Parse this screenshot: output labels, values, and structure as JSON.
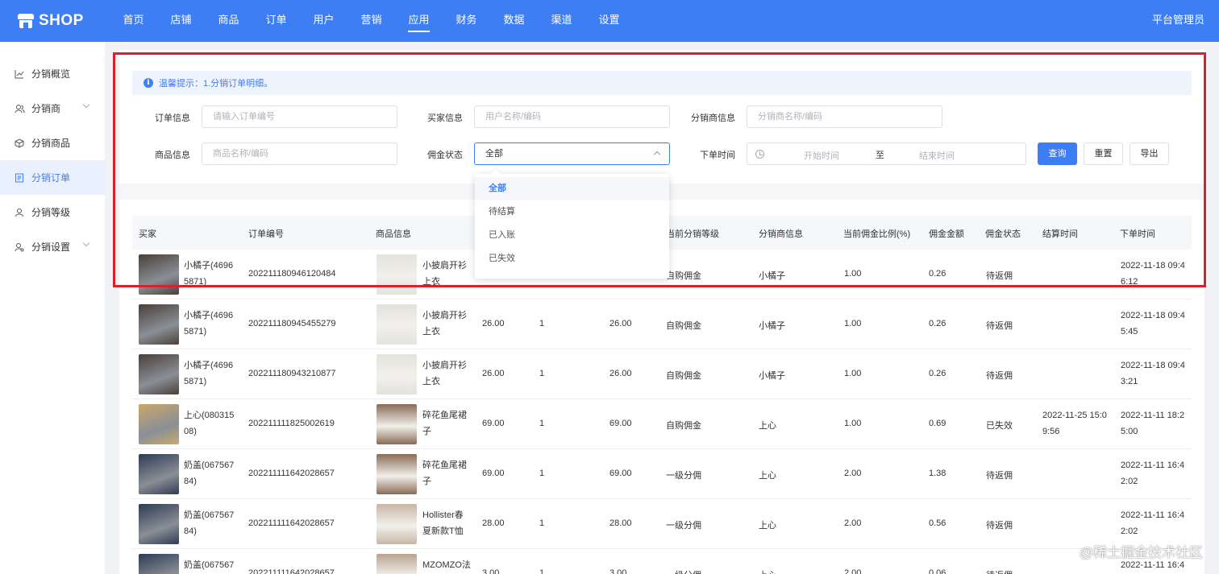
{
  "header": {
    "logo_text": "SHOP",
    "nav": [
      "首页",
      "店铺",
      "商品",
      "订单",
      "用户",
      "营销",
      "应用",
      "财务",
      "数据",
      "渠道",
      "设置"
    ],
    "active_nav": "应用",
    "admin": "平台管理员"
  },
  "sidebar": {
    "items": [
      {
        "label": "分销概览",
        "icon": "chart-line-icon"
      },
      {
        "label": "分销商",
        "icon": "users-icon"
      },
      {
        "label": "分销商品",
        "icon": "box-icon"
      },
      {
        "label": "分销订单",
        "icon": "order-doc-icon"
      },
      {
        "label": "分销等级",
        "icon": "user-level-icon"
      },
      {
        "label": "分销设置",
        "icon": "user-settings-icon"
      }
    ],
    "active": "分销订单"
  },
  "tip": {
    "text": "温馨提示：1.分销订单明细。"
  },
  "filters": {
    "order_label": "订单信息",
    "order_placeholder": "请输入订单编号",
    "buyer_label": "买家信息",
    "buyer_placeholder": "用户名称/编码",
    "distributor_label": "分销商信息",
    "distributor_placeholder": "分销商名称/编码",
    "goods_label": "商品信息",
    "goods_placeholder": "商品名称/编码",
    "commission_status_label": "佣金状态",
    "commission_status_value": "全部",
    "order_time_label": "下单时间",
    "start_time_placeholder": "开始时间",
    "range_separator": "至",
    "end_time_placeholder": "结束时间",
    "query_button": "查询",
    "reset_button": "重置",
    "export_button": "导出"
  },
  "dropdown": {
    "options": [
      "全部",
      "待结算",
      "已入账",
      "已失效"
    ],
    "selected": "全部"
  },
  "table": {
    "columns": [
      "买家",
      "订单编号",
      "商品信息",
      "当前分销等级",
      "分销商信息",
      "当前佣金比例(%)",
      "佣金金额",
      "佣金状态",
      "结算时间",
      "下单时间"
    ],
    "rows": [
      {
        "buyer_l1": "小橘子(4696",
        "buyer_l2": "5871)",
        "order_no": "202211180946120484",
        "goods_l1": "小披肩开衫",
        "goods_l2": "上衣",
        "price": "",
        "qty": "",
        "amount": "",
        "level": "自购佣金",
        "distributor": "小橘子",
        "rate": "1.00",
        "commission": "0.26",
        "status": "待返佣",
        "settle_l1": "",
        "settle_l2": "",
        "time_l1": "2022-11-18 09:4",
        "time_l2": "6:12"
      },
      {
        "buyer_l1": "小橘子(4696",
        "buyer_l2": "5871)",
        "order_no": "202211180945455279",
        "goods_l1": "小披肩开衫",
        "goods_l2": "上衣",
        "price": "26.00",
        "qty": "1",
        "amount": "26.00",
        "level": "自购佣金",
        "distributor": "小橘子",
        "rate": "1.00",
        "commission": "0.26",
        "status": "待返佣",
        "settle_l1": "",
        "settle_l2": "",
        "time_l1": "2022-11-18 09:4",
        "time_l2": "5:45"
      },
      {
        "buyer_l1": "小橘子(4696",
        "buyer_l2": "5871)",
        "order_no": "202211180943210877",
        "goods_l1": "小披肩开衫",
        "goods_l2": "上衣",
        "price": "26.00",
        "qty": "1",
        "amount": "26.00",
        "level": "自购佣金",
        "distributor": "小橘子",
        "rate": "1.00",
        "commission": "0.26",
        "status": "待返佣",
        "settle_l1": "",
        "settle_l2": "",
        "time_l1": "2022-11-18 09:4",
        "time_l2": "3:21"
      },
      {
        "buyer_l1": "上心(080315",
        "buyer_l2": "08)",
        "order_no": "202211111825002619",
        "goods_l1": "碎花鱼尾裙",
        "goods_l2": "子",
        "price": "69.00",
        "qty": "1",
        "amount": "69.00",
        "level": "自购佣金",
        "distributor": "上心",
        "rate": "1.00",
        "commission": "0.69",
        "status": "已失效",
        "settle_l1": "2022-11-25 15:0",
        "settle_l2": "9:56",
        "time_l1": "2022-11-11 18:2",
        "time_l2": "5:00"
      },
      {
        "buyer_l1": "奶盖(067567",
        "buyer_l2": "84)",
        "order_no": "202211111642028657",
        "goods_l1": "碎花鱼尾裙",
        "goods_l2": "子",
        "price": "69.00",
        "qty": "1",
        "amount": "69.00",
        "level": "一级分佣",
        "distributor": "上心",
        "rate": "2.00",
        "commission": "1.38",
        "status": "待返佣",
        "settle_l1": "",
        "settle_l2": "",
        "time_l1": "2022-11-11 16:4",
        "time_l2": "2:02"
      },
      {
        "buyer_l1": "奶盖(067567",
        "buyer_l2": "84)",
        "order_no": "202211111642028657",
        "goods_l1": "Hollister春",
        "goods_l2": "夏新款T恤",
        "price": "28.00",
        "qty": "1",
        "amount": "28.00",
        "level": "一级分佣",
        "distributor": "上心",
        "rate": "2.00",
        "commission": "0.56",
        "status": "待返佣",
        "settle_l1": "",
        "settle_l2": "",
        "time_l1": "2022-11-11 16:4",
        "time_l2": "2:02"
      },
      {
        "buyer_l1": "奶盖(067567",
        "buyer_l2": "",
        "order_no": "202211111642028657",
        "goods_l1": "MZOMZO法",
        "goods_l2": "",
        "price": "3.00",
        "qty": "1",
        "amount": "3.00",
        "level": "一级分佣",
        "distributor": "上心",
        "rate": "2.00",
        "commission": "0.06",
        "status": "待返佣",
        "settle_l1": "",
        "settle_l2": "",
        "time_l1": "2022-11-11 16:4",
        "time_l2": ""
      }
    ]
  },
  "watermark": "@稀土掘金技术社区",
  "colors": {
    "primary": "#3d7ef5",
    "highlight_frame": "#d7222d"
  }
}
